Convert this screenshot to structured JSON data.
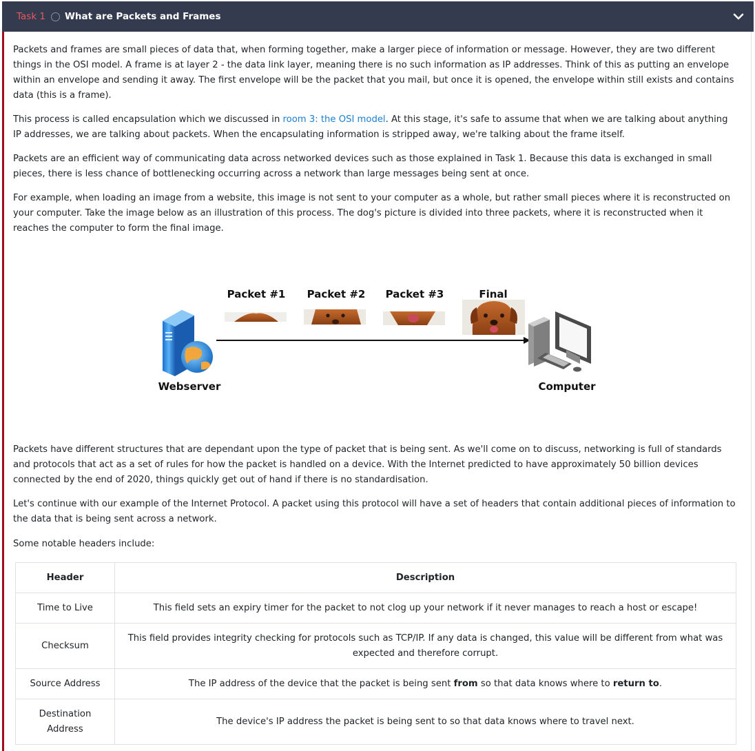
{
  "task": {
    "number": "Task 1",
    "title": "What are Packets and Frames"
  },
  "paragraphs": {
    "p1": "Packets and frames are small pieces of data that, when forming together, make a larger piece of information or message. However, they are two different things in the OSI model. A frame is at layer 2 - the data link layer, meaning there is no such information as IP addresses. Think of this as putting an envelope within an envelope and sending it away. The first envelope will be the packet that you mail, but once it is opened, the envelope within still exists and contains data (this is a frame).",
    "p2_before": "This process is called encapsulation which we discussed in ",
    "p2_link": "room 3: the OSI model",
    "p2_after": ". At this stage, it's safe to assume that when we are talking about anything IP addresses, we are talking about packets. When the encapsulating information is stripped away, we're talking about the frame itself.",
    "p3": "Packets are an efficient way of communicating data across networked devices such as those explained in Task 1. Because this data is exchanged in small pieces, there is less chance of bottlenecking occurring across a network than large messages being sent at once.",
    "p4": "For example, when loading an image from a website, this image is not sent to your computer as a whole, but rather small pieces where it is reconstructed on your computer. Take the image below as an illustration of this process. The dog's picture is divided into three packets, where it is reconstructed when it reaches the computer to form the final image.",
    "p5": "Packets have different structures that are dependant upon the type of packet that is being sent. As we'll come on to discuss, networking is full of standards and protocols that act as a set of rules for how the packet is handled on a device. With the Internet predicted to have approximately 50 billion devices connected by the end of 2020, things quickly get out of hand if there is no standardisation.",
    "p6": "Let's continue with our example of the Internet Protocol. A packet using this protocol will have a set of headers that contain additional pieces of information to the data that is being sent across a network.",
    "p7": "Some notable headers include:"
  },
  "figure": {
    "packet1": "Packet #1",
    "packet2": "Packet #2",
    "packet3": "Packet #3",
    "final": "Final",
    "webserver": "Webserver",
    "computer": "Computer"
  },
  "table": {
    "col_header": "Header",
    "col_description": "Description",
    "rows": [
      {
        "header": "Time to Live",
        "description": "This field sets an expiry timer for the packet to not clog up your network if it never manages to reach a host or escape!"
      },
      {
        "header": "Checksum",
        "description": "This field provides integrity checking for protocols such as TCP/IP. If any data is changed, this value will be different from what was expected and therefore corrupt."
      },
      {
        "header": "Source Address",
        "description_before": "The IP address of the device that the packet is being sent ",
        "description_bold1": "from",
        "description_mid": " so that data knows where to ",
        "description_bold2": "return to",
        "description_after": "."
      },
      {
        "header": "Destination Address",
        "description": "The device's IP address the packet is being sent to so that data knows where to travel next."
      }
    ]
  },
  "colors": {
    "header_bg": "#343b4f",
    "task_number": "#e8585f",
    "accent_border": "#a00d1e",
    "link": "#1a7fd3"
  }
}
